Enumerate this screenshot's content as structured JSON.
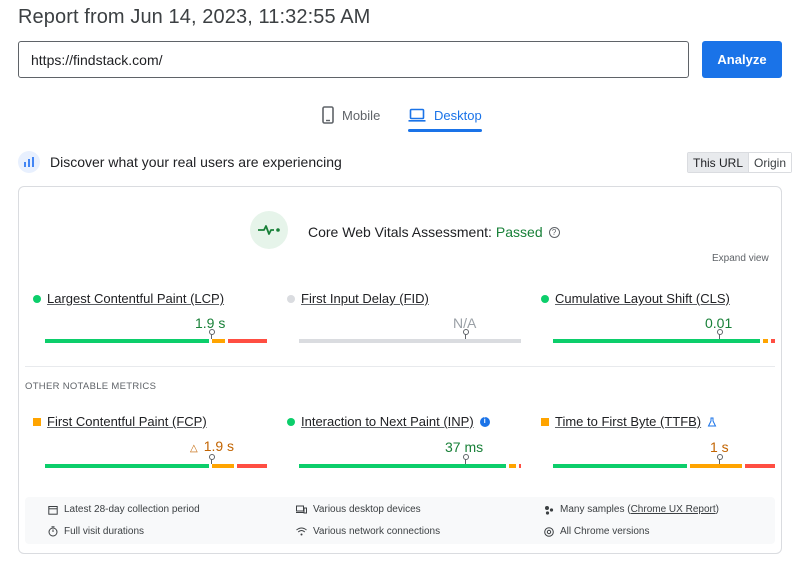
{
  "header": {
    "title": "Report from Jun 14, 2023, 11:32:55 AM"
  },
  "url_bar": {
    "value": "https://findstack.com/",
    "analyze_label": "Analyze"
  },
  "tabs": [
    {
      "label": "Mobile",
      "icon": "smartphone-icon"
    },
    {
      "label": "Desktop",
      "icon": "laptop-icon"
    }
  ],
  "discover": {
    "text": "Discover what your real users are experiencing",
    "scope": [
      "This URL",
      "Origin"
    ]
  },
  "assessment": {
    "label": "Core Web Vitals Assessment:",
    "status": "Passed"
  },
  "expand_label": "Expand view",
  "core_metrics": [
    {
      "name": "Largest Contentful Paint (LCP)",
      "value": "1.9 s",
      "rating": "good",
      "distribution": [
        0.76,
        0.06,
        0.18
      ],
      "marker": 0.75
    },
    {
      "name": "First Input Delay (FID)",
      "value": "N/A",
      "rating": "none",
      "distribution": [
        1.0
      ],
      "marker": 0.75
    },
    {
      "name": "Cumulative Layout Shift (CLS)",
      "value": "0.01",
      "rating": "good",
      "distribution": [
        0.96,
        0.02,
        0.02
      ],
      "marker": 0.75
    }
  ],
  "other_metrics_label": "OTHER NOTABLE METRICS",
  "other_metrics": [
    {
      "name": "First Contentful Paint (FCP)",
      "value": "1.9 s",
      "rating": "needs-improvement",
      "distribution": [
        0.76,
        0.1,
        0.14
      ],
      "marker": 0.75
    },
    {
      "name": "Interaction to Next Paint (INP)",
      "value": "37 ms",
      "rating": "good",
      "distribution": [
        0.96,
        0.03,
        0.01
      ],
      "marker": 0.75
    },
    {
      "name": "Time to First Byte (TTFB)",
      "value": "1 s",
      "rating": "needs-improvement",
      "distribution": [
        0.62,
        0.24,
        0.14
      ],
      "marker": 0.75
    }
  ],
  "footer": {
    "items": [
      {
        "text": "Latest 28-day collection period",
        "icon": "calendar-icon"
      },
      {
        "text": "Various desktop devices",
        "icon": "devices-icon"
      },
      {
        "text_prefix": "Many samples (",
        "link": "Chrome UX Report",
        "text_suffix": ")",
        "icon": "samples-icon"
      },
      {
        "text": "Full visit durations",
        "icon": "stopwatch-icon"
      },
      {
        "text": "Various network connections",
        "icon": "wifi-icon"
      },
      {
        "text": "All Chrome versions",
        "icon": "chrome-icon"
      }
    ]
  },
  "colors": {
    "good": "#0cce6b",
    "needs_improvement": "#ffa400",
    "poor": "#ff4e42",
    "none": "#dadce0",
    "accent": "#1a73e8",
    "passed": "#188038"
  }
}
